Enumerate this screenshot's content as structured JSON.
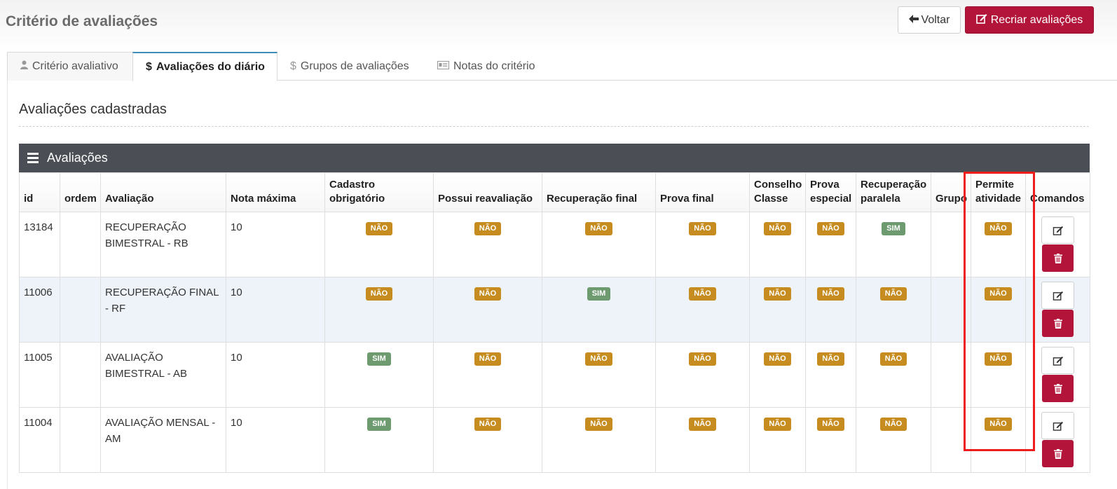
{
  "header": {
    "title": "Critério de avaliações",
    "back_label": "Voltar",
    "recreate_label": "Recriar avaliações"
  },
  "tabs": [
    {
      "label": "Critério avaliativo",
      "icon": "user-icon"
    },
    {
      "label": "Avaliações do diário",
      "icon": "dollar-icon",
      "prefix": "$"
    },
    {
      "label": "Grupos de avaliações",
      "icon": "dollar-icon",
      "prefix": "$"
    },
    {
      "label": "Notas do critério",
      "icon": "id-card-icon"
    }
  ],
  "section": {
    "title": "Avaliações cadastradas"
  },
  "box": {
    "title": "Avaliações"
  },
  "table": {
    "headers": {
      "id": "id",
      "ordem": "ordem",
      "avaliacao": "Avaliação",
      "nota_maxima": "Nota máxima",
      "cadastro_obrigatorio": "Cadastro obrigatório",
      "possui_reavaliacao": "Possui reavaliação",
      "recuperacao_final": "Recuperação final",
      "prova_final": "Prova final",
      "conselho_classe": "Conselho Classe",
      "prova_especial": "Prova especial",
      "recuperacao_paralela": "Recuperação paralela",
      "grupo": "Grupo",
      "permite_atividade": "Permite atividade",
      "comandos": "Comandos"
    },
    "rows": [
      {
        "id": "13184",
        "ordem": "",
        "avaliacao": "RECUPERAÇÃO BIMESTRAL - RB",
        "nota_maxima": "10",
        "cadastro_obrigatorio": "NÃO",
        "possui_reavaliacao": "NÃO",
        "recuperacao_final": "NÃO",
        "prova_final": "NÃO",
        "conselho_classe": "NÃO",
        "prova_especial": "NÃO",
        "recuperacao_paralela": "SIM",
        "grupo": "",
        "permite_atividade": "NÃO"
      },
      {
        "id": "11006",
        "ordem": "",
        "avaliacao": "RECUPERAÇÃO FINAL - RF",
        "nota_maxima": "10",
        "cadastro_obrigatorio": "NÃO",
        "possui_reavaliacao": "NÃO",
        "recuperacao_final": "SIM",
        "prova_final": "NÃO",
        "conselho_classe": "NÃO",
        "prova_especial": "NÃO",
        "recuperacao_paralela": "NÃO",
        "grupo": "",
        "permite_atividade": "NÃO"
      },
      {
        "id": "11005",
        "ordem": "",
        "avaliacao": "AVALIAÇÃO BIMESTRAL - AB",
        "nota_maxima": "10",
        "cadastro_obrigatorio": "SIM",
        "possui_reavaliacao": "NÃO",
        "recuperacao_final": "NÃO",
        "prova_final": "NÃO",
        "conselho_classe": "NÃO",
        "prova_especial": "NÃO",
        "recuperacao_paralela": "NÃO",
        "grupo": "",
        "permite_atividade": "NÃO"
      },
      {
        "id": "11004",
        "ordem": "",
        "avaliacao": "AVALIAÇÃO MENSAL - AM",
        "nota_maxima": "10",
        "cadastro_obrigatorio": "SIM",
        "possui_reavaliacao": "NÃO",
        "recuperacao_final": "NÃO",
        "prova_final": "NÃO",
        "conselho_classe": "NÃO",
        "prova_especial": "NÃO",
        "recuperacao_paralela": "NÃO",
        "grupo": "",
        "permite_atividade": "NÃO"
      }
    ]
  },
  "colors": {
    "danger": "#b3143a",
    "badge_nao": "#c78c1f",
    "badge_sim": "#6d9b6f",
    "box_header": "#4b4f55",
    "highlight": "#ee1c1c"
  }
}
